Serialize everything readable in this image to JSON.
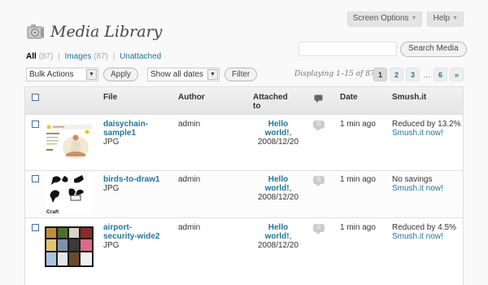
{
  "header": {
    "screen_options": "Screen Options",
    "help": "Help",
    "title": "Media Library"
  },
  "search": {
    "button": "Search Media"
  },
  "filters": {
    "all": "All",
    "all_count": "(87)",
    "images": "Images",
    "images_count": "(87)",
    "sep": "|",
    "unattached": "Unattached"
  },
  "actions": {
    "bulk": "Bulk Actions",
    "apply": "Apply",
    "dates": "Show all dates",
    "filter": "Filter"
  },
  "pagination": {
    "displaying": "Displaying 1–15 of 87",
    "pages": [
      "1",
      "2",
      "3"
    ],
    "dots": "…",
    "last": "6",
    "next": "»"
  },
  "columns": {
    "file": "File",
    "author": "Author",
    "attached": "Attached to",
    "date": "Date",
    "smush": "Smush.it"
  },
  "rows": [
    {
      "name": "daisychain-sample1",
      "name_l1": "daisychain-",
      "name_l2": "sample1",
      "type": "JPG",
      "author": "admin",
      "attach_l1": "Hello",
      "attach_l2": "world!",
      "attach_suffix": ",",
      "attach_date": "2008/12/20",
      "comments": "0",
      "date": "1 min ago",
      "smush_status": "Reduced by 13.2%",
      "smush_link": "Smush.it now!"
    },
    {
      "name": "birds-to-draw1",
      "name_l1": "birds-to-draw1",
      "name_l2": "",
      "type": "JPG",
      "author": "admin",
      "attach_l1": "Hello",
      "attach_l2": "world!",
      "attach_suffix": ",",
      "attach_date": "2008/12/20",
      "comments": "0",
      "date": "1 min ago",
      "smush_status": "No savings",
      "smush_link": "Smush.it now!",
      "thumb_text": "Craft"
    },
    {
      "name": "airport-security-wide2",
      "name_l1": "airport-",
      "name_l2": "security-wide2",
      "type": "JPG",
      "author": "admin",
      "attach_l1": "Hello",
      "attach_l2": "world!",
      "attach_suffix": ",",
      "attach_date": "2008/12/20",
      "comments": "0",
      "date": "1 min ago",
      "smush_status": "Reduced by 4.5%",
      "smush_link": "Smush.it now!"
    }
  ]
}
